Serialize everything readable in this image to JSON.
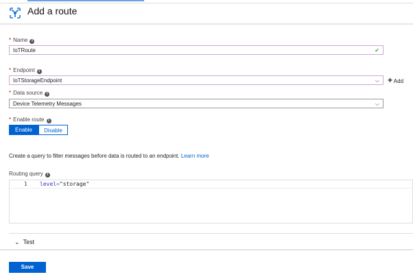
{
  "header": {
    "title": "Add a route"
  },
  "name": {
    "label": "Name",
    "value": "IoTRoute"
  },
  "endpoint": {
    "label": "Endpoint",
    "value": "IoTStorageEndpoint",
    "add_label": "Add"
  },
  "data_source": {
    "label": "Data source",
    "value": "Device Telemetry Messages"
  },
  "enable_route": {
    "label": "Enable route",
    "enable": "Enable",
    "disable": "Disable"
  },
  "description": {
    "text": "Create a query to filter messages before data is routed to an endpoint.",
    "link": "Learn more"
  },
  "routing_query": {
    "label": "Routing query",
    "line_number": "1",
    "keyword": "level",
    "op": "=",
    "string": "\"storage\""
  },
  "test": {
    "label": "Test"
  },
  "save_label": "Save",
  "colors": {
    "accent": "#0063d1",
    "required": "#cc0000"
  }
}
